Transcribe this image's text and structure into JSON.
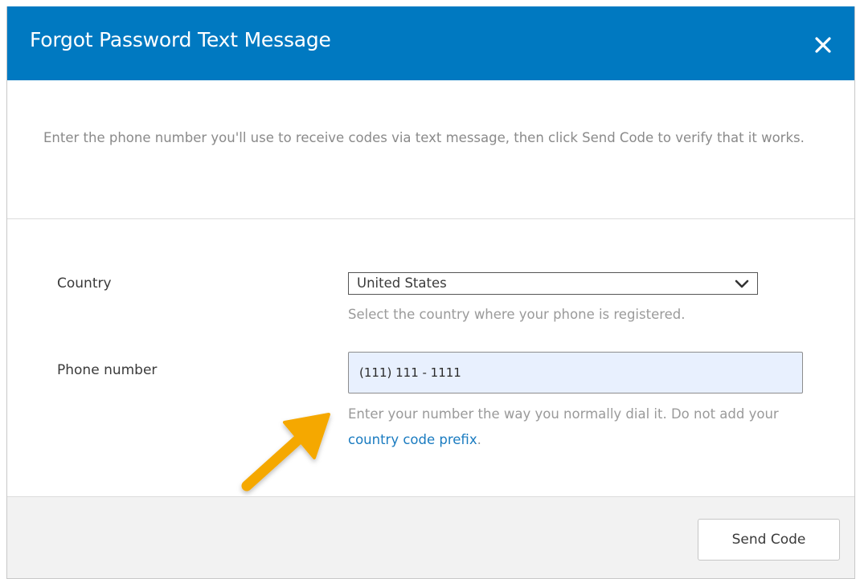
{
  "dialog": {
    "title": "Forgot Password Text Message",
    "close_icon": "close-icon",
    "intro_text": "Enter the phone number you'll use to receive codes via text message, then click Send Code to verify that it works."
  },
  "form": {
    "country": {
      "label": "Country",
      "selected_value": "United States",
      "hint": "Select the country where your phone is registered.",
      "chevron_icon": "chevron-down-icon"
    },
    "phone": {
      "label": "Phone number",
      "value": "(111) 111 - 1111",
      "hint_prefix": "Enter your number the way you normally dial it. Do not add your ",
      "hint_link": "country code prefix",
      "hint_suffix": "."
    }
  },
  "annotation": {
    "arrow_icon": "arrow-icon",
    "arrow_color": "#f5a800"
  },
  "footer": {
    "send_label": "Send Code"
  },
  "colors": {
    "header_bg": "#0079c1",
    "link": "#1a7bc0",
    "input_bg": "#e8f0fe"
  }
}
